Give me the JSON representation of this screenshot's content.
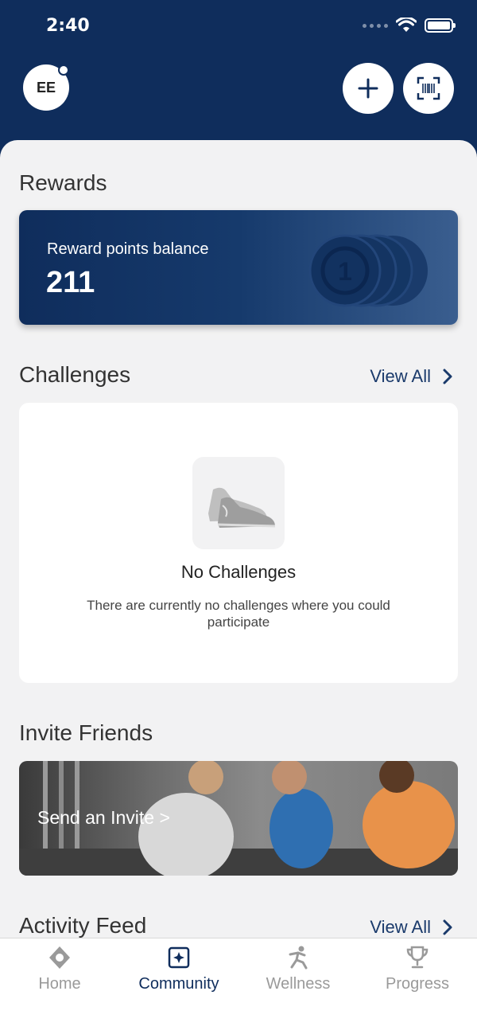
{
  "status_bar": {
    "time": "2:40"
  },
  "header": {
    "avatar_initials": "EE"
  },
  "rewards": {
    "section_title": "Rewards",
    "balance_label": "Reward points balance",
    "balance_value": "211",
    "coin_label": "1"
  },
  "challenges": {
    "section_title": "Challenges",
    "view_all": "View All",
    "empty_title": "No Challenges",
    "empty_description": "There are currently no challenges where you could participate"
  },
  "invite": {
    "section_title": "Invite Friends",
    "cta": "Send an Invite >"
  },
  "activity_feed": {
    "section_title": "Activity Feed",
    "view_all": "View All"
  },
  "tabbar": {
    "items": [
      {
        "label": "Home",
        "icon": "home-icon"
      },
      {
        "label": "Community",
        "icon": "community-icon"
      },
      {
        "label": "Wellness",
        "icon": "wellness-icon"
      },
      {
        "label": "Progress",
        "icon": "trophy-icon"
      }
    ],
    "active": "Community"
  },
  "colors": {
    "primary": "#0f2d5c",
    "background": "#f2f2f3",
    "inactive": "#9a9a9a"
  }
}
